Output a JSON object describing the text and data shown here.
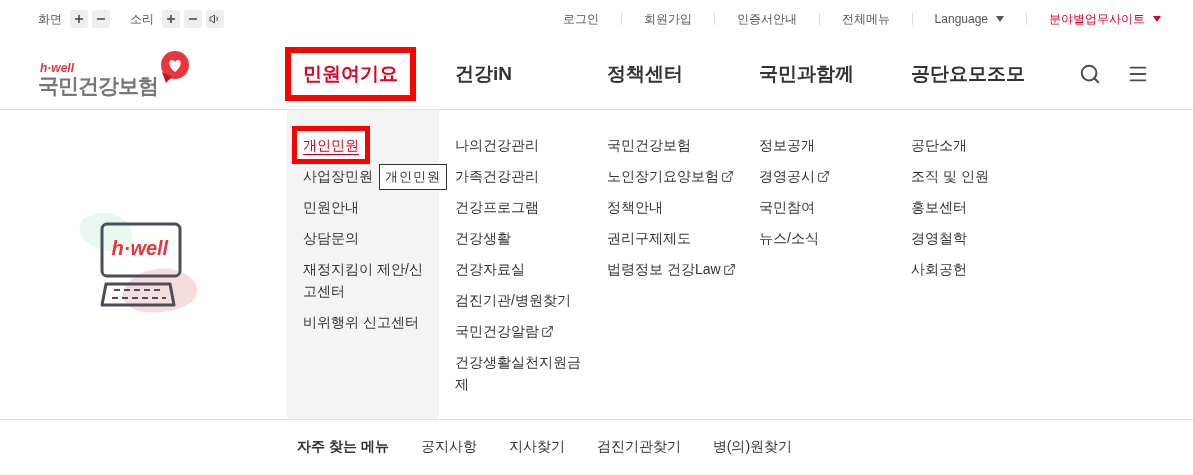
{
  "display_controls": [
    {
      "label": "화면",
      "has_speaker": false
    },
    {
      "label": "소리",
      "has_speaker": true
    }
  ],
  "top_links": [
    {
      "label": "로그인",
      "dropdown": false,
      "highlight": false
    },
    {
      "label": "회원가입",
      "dropdown": false,
      "highlight": false
    },
    {
      "label": "인증서안내",
      "dropdown": false,
      "highlight": false
    },
    {
      "label": "전체메뉴",
      "dropdown": false,
      "highlight": false
    },
    {
      "label": "Language",
      "dropdown": true,
      "highlight": false
    },
    {
      "label": "분야별업무사이트",
      "dropdown": true,
      "highlight": true
    }
  ],
  "logo": {
    "tagline": "h·well",
    "name": "국민건강보험"
  },
  "nav": [
    {
      "label": "민원여기요",
      "selected": true
    },
    {
      "label": "건강iN",
      "selected": false
    },
    {
      "label": "정책센터",
      "selected": false
    },
    {
      "label": "국민과함께",
      "selected": false
    },
    {
      "label": "공단요모조모",
      "selected": false
    }
  ],
  "illustration": {
    "screen_text": "h·well"
  },
  "menu_columns": [
    {
      "items": [
        {
          "label": "개인민원",
          "selected": true,
          "external": false
        },
        {
          "label": "사업장민원",
          "selected": false,
          "external": false
        },
        {
          "label": "민원안내",
          "selected": false,
          "external": false
        },
        {
          "label": "상담문의",
          "selected": false,
          "external": false
        },
        {
          "label": "재정지킴이 제안/신고센터",
          "selected": false,
          "external": false
        },
        {
          "label": "비위행위 신고센터",
          "selected": false,
          "external": false
        }
      ]
    },
    {
      "items": [
        {
          "label": "나의건강관리",
          "selected": false,
          "external": false
        },
        {
          "label": "가족건강관리",
          "selected": false,
          "external": false
        },
        {
          "label": "건강프로그램",
          "selected": false,
          "external": false
        },
        {
          "label": "건강생활",
          "selected": false,
          "external": false
        },
        {
          "label": "건강자료실",
          "selected": false,
          "external": false
        },
        {
          "label": "검진기관/병원찾기",
          "selected": false,
          "external": false
        },
        {
          "label": "국민건강알람",
          "selected": false,
          "external": true
        },
        {
          "label": "건강생활실천지원금제",
          "selected": false,
          "external": false
        }
      ]
    },
    {
      "items": [
        {
          "label": "국민건강보험",
          "selected": false,
          "external": false
        },
        {
          "label": "노인장기요양보험",
          "selected": false,
          "external": true
        },
        {
          "label": "정책안내",
          "selected": false,
          "external": false
        },
        {
          "label": "권리구제제도",
          "selected": false,
          "external": false
        },
        {
          "label": "법령정보 건강Law",
          "selected": false,
          "external": true
        }
      ]
    },
    {
      "items": [
        {
          "label": "정보공개",
          "selected": false,
          "external": false
        },
        {
          "label": "경영공시",
          "selected": false,
          "external": true
        },
        {
          "label": "국민참여",
          "selected": false,
          "external": false
        },
        {
          "label": "뉴스/소식",
          "selected": false,
          "external": false
        }
      ]
    },
    {
      "items": [
        {
          "label": "공단소개",
          "selected": false,
          "external": false
        },
        {
          "label": "조직 및 인원",
          "selected": false,
          "external": false
        },
        {
          "label": "홍보센터",
          "selected": false,
          "external": false
        },
        {
          "label": "경영철학",
          "selected": false,
          "external": false
        },
        {
          "label": "사회공헌",
          "selected": false,
          "external": false
        }
      ]
    }
  ],
  "tooltip": "개인민원",
  "quick_menu": {
    "title": "자주 찾는 메뉴",
    "links": [
      "공지사항",
      "지사찾기",
      "검진기관찾기",
      "병(의)원찾기"
    ]
  }
}
